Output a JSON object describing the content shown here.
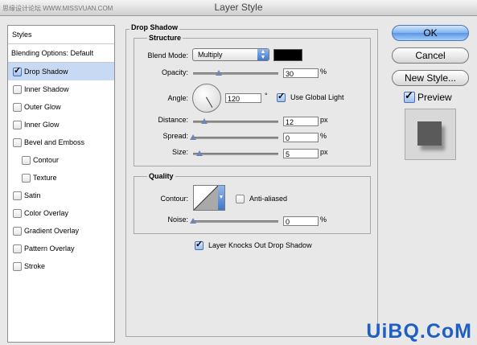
{
  "window": {
    "title": "Layer Style",
    "watermark_top": "思缘设计论坛 WWW.MISSVUAN.COM"
  },
  "styles_panel": {
    "header": "Styles",
    "blending": "Blending Options: Default",
    "items": [
      {
        "label": "Drop Shadow",
        "checked": true
      },
      {
        "label": "Inner Shadow",
        "checked": false
      },
      {
        "label": "Outer Glow",
        "checked": false
      },
      {
        "label": "Inner Glow",
        "checked": false
      },
      {
        "label": "Bevel and Emboss",
        "checked": false
      },
      {
        "label": "Contour",
        "checked": false
      },
      {
        "label": "Texture",
        "checked": false
      },
      {
        "label": "Satin",
        "checked": false
      },
      {
        "label": "Color Overlay",
        "checked": false
      },
      {
        "label": "Gradient Overlay",
        "checked": false
      },
      {
        "label": "Pattern Overlay",
        "checked": false
      },
      {
        "label": "Stroke",
        "checked": false
      }
    ]
  },
  "drop_shadow": {
    "title": "Drop Shadow",
    "structure": {
      "title": "Structure",
      "blend_mode_label": "Blend Mode:",
      "blend_mode_value": "Multiply",
      "shadow_color": "#000000",
      "opacity_label": "Opacity:",
      "opacity_value": "30",
      "opacity_unit": "%",
      "angle_label": "Angle:",
      "angle_value": "120",
      "angle_unit": "°",
      "global_light_label": "Use Global Light",
      "global_light_checked": true,
      "distance_label": "Distance:",
      "distance_value": "12",
      "distance_unit": "px",
      "spread_label": "Spread:",
      "spread_value": "0",
      "spread_unit": "%",
      "size_label": "Size:",
      "size_value": "5",
      "size_unit": "px"
    },
    "quality": {
      "title": "Quality",
      "contour_label": "Contour:",
      "anti_aliased_label": "Anti-aliased",
      "anti_aliased_checked": false,
      "noise_label": "Noise:",
      "noise_value": "0",
      "noise_unit": "%"
    },
    "knockout_label": "Layer Knocks Out Drop Shadow",
    "knockout_checked": true
  },
  "buttons": {
    "ok": "OK",
    "cancel": "Cancel",
    "new_style": "New Style..."
  },
  "preview": {
    "label": "Preview",
    "checked": true
  },
  "footer_watermark": "UiBQ.CoM"
}
